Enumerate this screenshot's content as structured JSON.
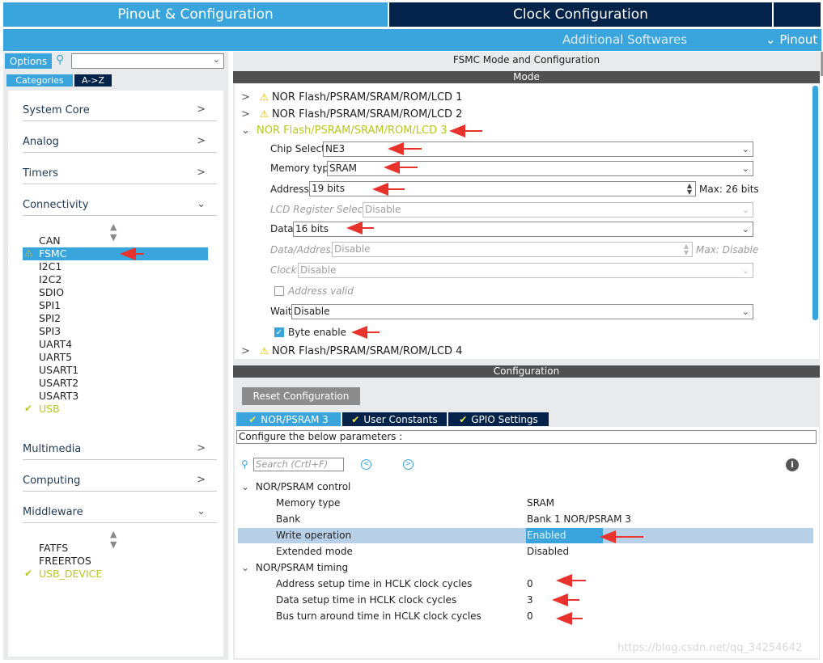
{
  "top_tabs": {
    "pinout": "Pinout & Configuration",
    "clock": "Clock Configuration",
    "additional": "Additional Softwares",
    "pinout_menu": "Pinout"
  },
  "left": {
    "options_label": "Options",
    "categories_label": "Categories",
    "az_label": "A->Z",
    "categories": [
      {
        "label": "System Core"
      },
      {
        "label": "Analog"
      },
      {
        "label": "Timers"
      },
      {
        "label": "Connectivity"
      },
      {
        "label": "Multimedia"
      },
      {
        "label": "Computing"
      },
      {
        "label": "Middleware"
      }
    ],
    "connectivity_items": [
      "CAN",
      "FSMC",
      "I2C1",
      "I2C2",
      "SDIO",
      "SPI1",
      "SPI2",
      "SPI3",
      "UART4",
      "UART5",
      "USART1",
      "USART2",
      "USART3",
      "USB"
    ],
    "middleware_items": [
      "FATFS",
      "FREERTOS",
      "USB_DEVICE"
    ]
  },
  "right": {
    "title": "FSMC Mode and Configuration",
    "mode_header": "Mode",
    "tree": [
      "NOR Flash/PSRAM/SRAM/ROM/LCD 1",
      "NOR Flash/PSRAM/SRAM/ROM/LCD 2",
      "NOR Flash/PSRAM/SRAM/ROM/LCD 3",
      "NOR Flash/PSRAM/SRAM/ROM/LCD 4"
    ],
    "fields": {
      "chip_select_label": "Chip Select",
      "chip_select_value": "NE3",
      "memory_type_label": "Memory type",
      "memory_type_value": "SRAM",
      "address_label": "Address",
      "address_value": "19 bits",
      "address_max": "Max: 26 bits",
      "lcd_reg_label": "LCD Register Select",
      "lcd_reg_value": "Disable",
      "data_label": "Data",
      "data_value": "16 bits",
      "data_address_label": "Data/Address",
      "data_address_value": "Disable",
      "data_address_max": "Max: Disable",
      "clock_label": "Clock",
      "clock_value": "Disable",
      "address_valid_label": "Address valid",
      "wait_label": "Wait",
      "wait_value": "Disable",
      "byte_enable_label": "Byte enable"
    },
    "config_header": "Configuration",
    "reset_label": "Reset Configuration",
    "config_tabs": [
      "NOR/PSRAM 3",
      "User Constants",
      "GPIO Settings"
    ],
    "param_hint": "Configure the below parameters :",
    "search_placeholder": "Search (Crtl+F)",
    "sections": [
      {
        "title": "NOR/PSRAM control",
        "params": [
          {
            "name": "Memory type",
            "value": "SRAM"
          },
          {
            "name": "Bank",
            "value": "Bank 1 NOR/PSRAM 3"
          },
          {
            "name": "Write operation",
            "value": "Enabled"
          },
          {
            "name": "Extended mode",
            "value": "Disabled"
          }
        ]
      },
      {
        "title": "NOR/PSRAM timing",
        "params": [
          {
            "name": "Address setup time in HCLK clock cycles",
            "value": "0"
          },
          {
            "name": "Data setup time in HCLK clock cycles",
            "value": "3"
          },
          {
            "name": "Bus turn around time in HCLK clock cycles",
            "value": "0"
          }
        ]
      }
    ]
  },
  "watermark": "https://blog.csdn.net/qq_34254642",
  "colors": {
    "accent": "#39a5dc",
    "dark": "#03234b",
    "green": "#b6c81f",
    "arrow": "#e8322c"
  }
}
